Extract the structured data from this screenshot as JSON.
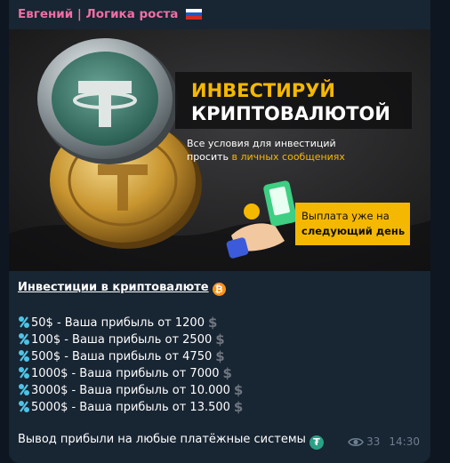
{
  "post": {
    "sender": "Евгений | Логика роста",
    "sender_flag": "russia-flag-icon",
    "banner": {
      "headline_line1": "ИНВЕСТИРУЙ",
      "headline_line2": "КРИПТОВАЛЮТОЙ",
      "conditions_line1": "Все условия для инвестиций",
      "conditions_line2_prefix": "просить ",
      "conditions_line2_highlight": "в личных сообщениях",
      "payout_line1": "Выплата уже на",
      "payout_line2": "следующий день",
      "accent_color": "#f5b800"
    },
    "title": "Инвестиции в криптовалюте",
    "title_icon": "bitcoin-icon",
    "rates": [
      {
        "text": "50$ - Ваша прибыль от 1200"
      },
      {
        "text": "100$ - Ваша прибыль от 2500"
      },
      {
        "text": "500$ - Ваша прибыль от 4750"
      },
      {
        "text": "1000$ - Ваша прибыль от 7000"
      },
      {
        "text": "3000$ - Ваша прибыль от 10.000"
      },
      {
        "text": "5000$ - Ваша прибыль от 13.500"
      }
    ],
    "rate_prefix_icon": "percent-icon",
    "rate_suffix_icon": "heavy-dollar-sign-icon",
    "rate_suffix_glyph": "$",
    "footer_text": "Вывод прибыли на любые платёжные системы",
    "footer_icon": "tether-icon",
    "views": "33",
    "time": "14:30"
  }
}
